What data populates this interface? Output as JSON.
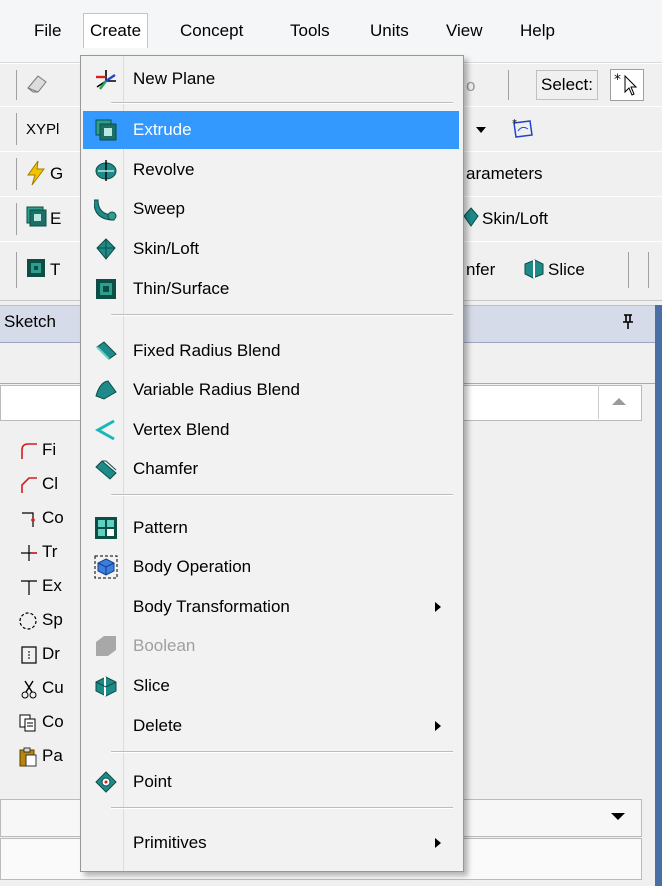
{
  "menubar": [
    "File",
    "Create",
    "Concept",
    "Tools",
    "Units",
    "View",
    "Help"
  ],
  "toolbars": {
    "row1_select_label": "Select:",
    "row2_plane_value": "XYPl",
    "row3_left": "G",
    "row3_right": "arameters",
    "row4_left": "E",
    "row4_right": "Skin/Loft",
    "row5_left": "T",
    "row5_chamfer": "nfer",
    "row5_slice": "Slice"
  },
  "panel": {
    "title": "Sketch",
    "pin": "↑",
    "tools": [
      "Fi",
      "Cl",
      "Co",
      "Tr",
      "Ex",
      "Sp",
      "Dr",
      "Cu",
      "Co",
      "Pa"
    ]
  },
  "dropdown": {
    "items": [
      {
        "label": "New Plane",
        "icon": "new-plane-icon"
      },
      {
        "label": "Extrude",
        "icon": "extrude-icon",
        "highlighted": true
      },
      {
        "label": "Revolve",
        "icon": "revolve-icon"
      },
      {
        "label": "Sweep",
        "icon": "sweep-icon"
      },
      {
        "label": "Skin/Loft",
        "icon": "skin-loft-icon"
      },
      {
        "label": "Thin/Surface",
        "icon": "thin-surface-icon"
      },
      {
        "label": "Fixed Radius Blend",
        "icon": "fixed-radius-blend-icon"
      },
      {
        "label": "Variable Radius Blend",
        "icon": "variable-radius-blend-icon"
      },
      {
        "label": "Vertex Blend",
        "icon": "vertex-blend-icon"
      },
      {
        "label": "Chamfer",
        "icon": "chamfer-icon"
      },
      {
        "label": "Pattern",
        "icon": "pattern-icon"
      },
      {
        "label": "Body Operation",
        "icon": "body-operation-icon"
      },
      {
        "label": "Body Transformation",
        "submenu": true
      },
      {
        "label": "Boolean",
        "icon": "boolean-icon",
        "disabled": true
      },
      {
        "label": "Slice",
        "icon": "slice-icon"
      },
      {
        "label": "Delete",
        "submenu": true
      },
      {
        "label": "Point",
        "icon": "point-icon"
      },
      {
        "label": "Primitives",
        "submenu": true
      }
    ]
  },
  "colors": {
    "highlight": "#3399ff",
    "icon_teal": "#1e8a8a",
    "icon_green": "#2e9e4f",
    "panel_header": "#d6dbe9"
  }
}
